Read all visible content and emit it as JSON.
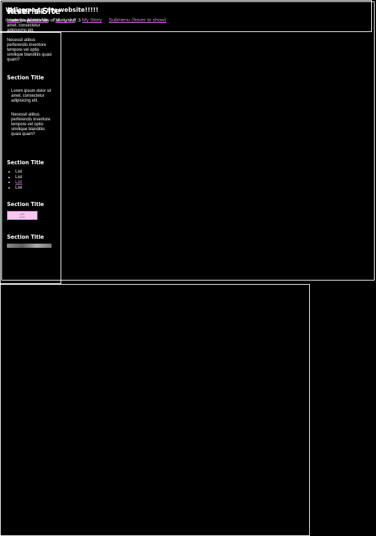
{
  "header": {
    "title": "River's Site",
    "nav": [
      "Home",
      "About Me",
      "My Links",
      "My Story",
      "Submenu (hover to show)"
    ]
  },
  "sidebar": {
    "sections": [
      {
        "title": "Section Title",
        "paragraphs": [
          "Lorem ipsum dolor sit amet, consectetur adipisicing elit.",
          "Necessit atibus perferendis inventore tempore vel optio similique blanditiis quasi quam?"
        ]
      },
      {
        "title": "Section Title",
        "paragraphs": [
          "Lorem ipsum dolor sit amet, consectetur adipisicing elit.",
          "Necessit atibus perferendis inventore tempore vel optio similique blanditiis quasi quam?"
        ]
      },
      {
        "title": "Section Title",
        "list": [
          "List",
          "List",
          "List",
          "List"
        ]
      },
      {
        "title": "Section Title",
        "button": [
          "petit",
          "pixel"
        ]
      },
      {
        "title": "Section Title"
      }
    ]
  },
  "main": {
    "title": "Welcome to my website!!!!!",
    "text": "I made this just to show off all my stuff :3"
  },
  "colors": {
    "background": "#000000",
    "border": "#ffffff",
    "link": "#e67af0",
    "button_bg": "#f3c9ee"
  }
}
